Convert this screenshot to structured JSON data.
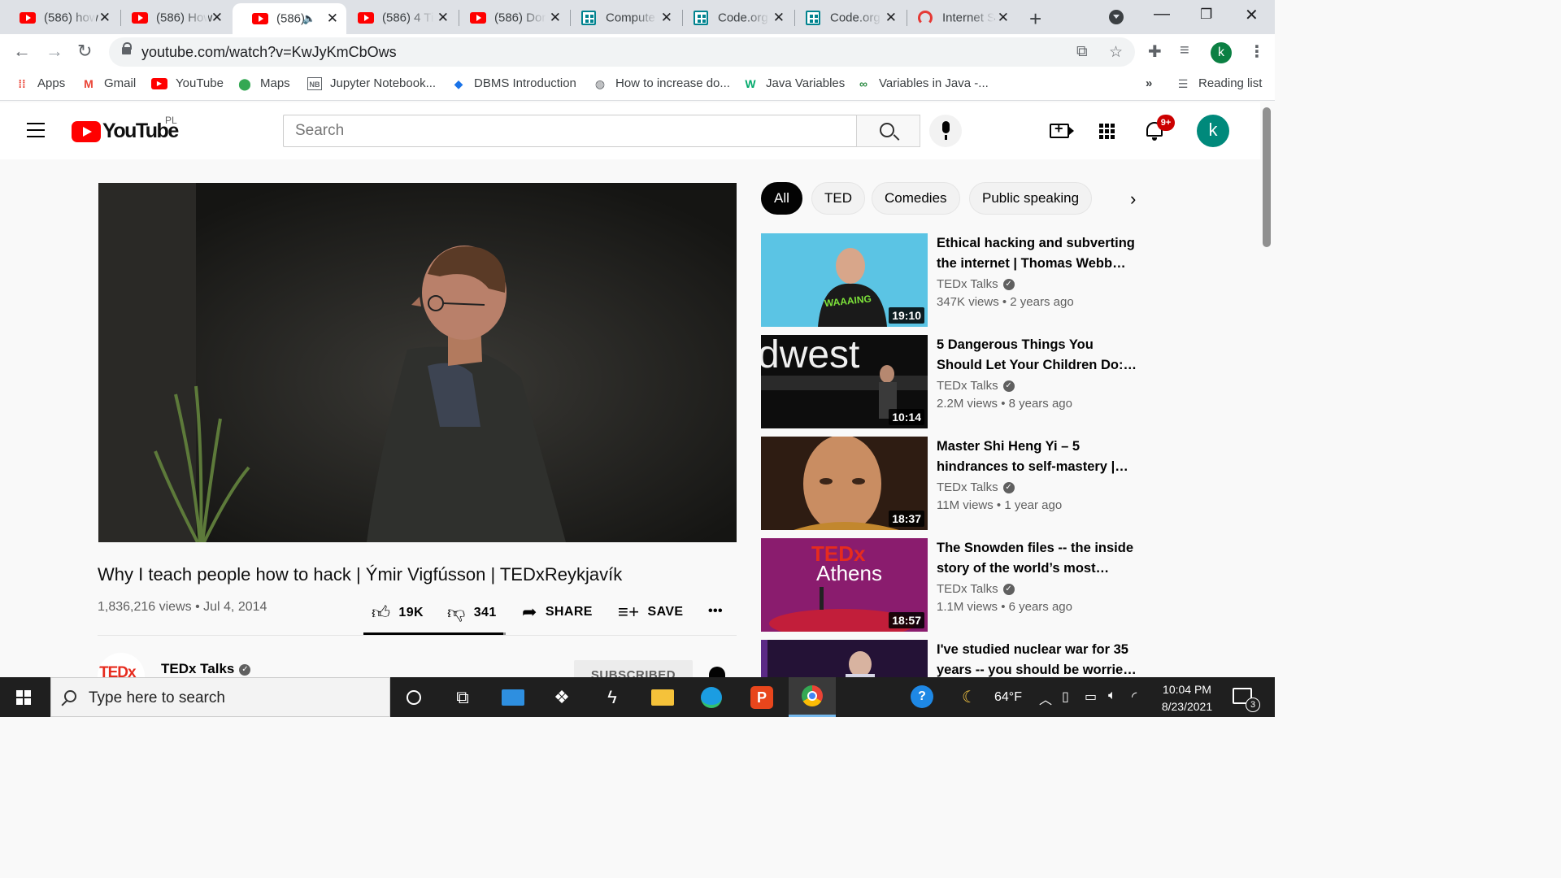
{
  "browser": {
    "tabs": [
      {
        "title": "(586) how",
        "favicon": "youtube-icon"
      },
      {
        "title": "(586) How",
        "favicon": "youtube-icon"
      },
      {
        "title": "(586)",
        "favicon": "youtube-icon",
        "audio": "speaker-icon",
        "active": true
      },
      {
        "title": "(586) 4 Ti",
        "favicon": "youtube-icon"
      },
      {
        "title": "(586) Dor",
        "favicon": "youtube-icon"
      },
      {
        "title": "Compute",
        "favicon": "code-org-icon"
      },
      {
        "title": "Code.org",
        "favicon": "code-org-icon"
      },
      {
        "title": "Code.org",
        "favicon": "code-org-icon"
      },
      {
        "title": "Internet S",
        "favicon": "speedtest-icon"
      }
    ],
    "new_tab": "+",
    "url": "youtube.com/watch?v=KwJyKmCbOws",
    "profile_initial": "k",
    "bookmarks": [
      {
        "label": "Apps",
        "icon": "apps-grid-icon"
      },
      {
        "label": "Gmail",
        "icon": "gmail-icon"
      },
      {
        "label": "YouTube",
        "icon": "youtube-icon"
      },
      {
        "label": "Maps",
        "icon": "maps-pin-icon"
      },
      {
        "label": "Jupyter Notebook...",
        "icon": "jupyter-icon"
      },
      {
        "label": "DBMS Introduction",
        "icon": "dbms-icon"
      },
      {
        "label": "How to increase do...",
        "icon": "globe-icon"
      },
      {
        "label": "Java Variables",
        "icon": "w3schools-icon"
      },
      {
        "label": "Variables in Java -...",
        "icon": "geeksforgeeks-icon"
      }
    ],
    "bookmarks_overflow": "»",
    "reading_list": "Reading list"
  },
  "youtube": {
    "logo_text": "YouTube",
    "country_code": "PL",
    "search_placeholder": "Search",
    "notification_count": "9+",
    "avatar_initial": "k",
    "video": {
      "title": "Why I teach people how to hack | Ýmir Vigfússon | TEDxReykjavík",
      "views_date": "1,836,216 views • Jul 4, 2014",
      "likes": "19K",
      "dislikes": "341",
      "like_ratio": 0.98,
      "share_label": "SHARE",
      "save_label": "SAVE",
      "more_label": "•••",
      "channel": "TEDx Talks",
      "channel_logo_text": "TEDx",
      "subscribe_label": "SUBSCRIBED"
    },
    "chips": [
      "All",
      "TED",
      "Comedies",
      "Public speaking"
    ],
    "recommendations": [
      {
        "title": "Ethical hacking and subverting the internet | Thomas Webb…",
        "channel": "TEDx Talks",
        "meta": "347K views • 2 years ago",
        "duration": "19:10"
      },
      {
        "title": "5 Dangerous Things You Should Let Your Children Do:…",
        "channel": "TEDx Talks",
        "meta": "2.2M views • 8 years ago",
        "duration": "10:14"
      },
      {
        "title": "Master Shi Heng Yi – 5 hindrances to self-mastery |…",
        "channel": "TEDx Talks",
        "meta": "11M views • 1 year ago",
        "duration": "18:37"
      },
      {
        "title": "The Snowden files -- the inside story of the world’s most…",
        "channel": "TEDx Talks",
        "meta": "1.1M views • 6 years ago",
        "duration": "18:57"
      },
      {
        "title": "I've studied nuclear war for 35 years -- you should be worrie…",
        "channel": "",
        "meta": "",
        "duration": ""
      }
    ],
    "thumb_texts": {
      "dwest": "dwest",
      "athens_brand": "TEDx",
      "athens_city": "Athens"
    }
  },
  "taskbar": {
    "search_placeholder": "Type here to search",
    "weather": "64°F",
    "time": "10:04 PM",
    "date": "8/23/2021",
    "notification_count": "3"
  },
  "colors": {
    "youtube_red": "#ff0000",
    "taskbar": "#1f1f1f",
    "avatar": "#00897b"
  }
}
